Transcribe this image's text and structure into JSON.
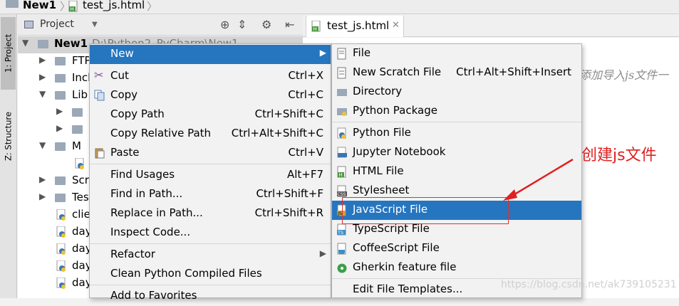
{
  "titlebar": {
    "project": "New1",
    "file": "test_js.html"
  },
  "leftstrip": {
    "project_tab": "1: Project",
    "structure_tab": "Z: Structure"
  },
  "project_panel": {
    "label": "Project"
  },
  "tree": {
    "root": {
      "label": "New1",
      "path": "D:\\Python2_PyCharm\\New1"
    },
    "rows": [
      "FTP",
      "Incl",
      "Lib",
      "",
      "",
      "M",
      "",
      "Scr",
      "Tes",
      "clie",
      "day",
      "day",
      "day",
      "day"
    ]
  },
  "editor": {
    "tab": "test_js.html",
    "comment": "添加导入js文件一"
  },
  "context_menu": {
    "items": [
      {
        "label": "New",
        "shortcut": ""
      },
      {
        "label": "Cut",
        "shortcut": "Ctrl+X"
      },
      {
        "label": "Copy",
        "shortcut": "Ctrl+C"
      },
      {
        "label": "Copy Path",
        "shortcut": "Ctrl+Shift+C"
      },
      {
        "label": "Copy Relative Path",
        "shortcut": "Ctrl+Alt+Shift+C"
      },
      {
        "label": "Paste",
        "shortcut": "Ctrl+V"
      },
      {
        "label": "Find Usages",
        "shortcut": "Alt+F7"
      },
      {
        "label": "Find in Path...",
        "shortcut": "Ctrl+Shift+F"
      },
      {
        "label": "Replace in Path...",
        "shortcut": "Ctrl+Shift+R"
      },
      {
        "label": "Inspect Code...",
        "shortcut": ""
      },
      {
        "label": "Refactor",
        "shortcut": ""
      },
      {
        "label": "Clean Python Compiled Files",
        "shortcut": ""
      },
      {
        "label": "Add to Favorites",
        "shortcut": ""
      }
    ]
  },
  "new_submenu": {
    "items": [
      {
        "label": "File",
        "shortcut": ""
      },
      {
        "label": "New Scratch File",
        "shortcut": "Ctrl+Alt+Shift+Insert"
      },
      {
        "label": "Directory",
        "shortcut": ""
      },
      {
        "label": "Python Package",
        "shortcut": ""
      },
      {
        "label": "Python File",
        "shortcut": ""
      },
      {
        "label": "Jupyter Notebook",
        "shortcut": ""
      },
      {
        "label": "HTML File",
        "shortcut": ""
      },
      {
        "label": "Stylesheet",
        "shortcut": ""
      },
      {
        "label": "JavaScript File",
        "shortcut": ""
      },
      {
        "label": "TypeScript File",
        "shortcut": ""
      },
      {
        "label": "CoffeeScript File",
        "shortcut": ""
      },
      {
        "label": "Gherkin feature file",
        "shortcut": ""
      },
      {
        "label": "Edit File Templates...",
        "shortcut": ""
      }
    ]
  },
  "annotation": {
    "text": "创建js文件",
    "color": "#e02020"
  },
  "watermark": "https://blog.csdn.net/ak739105231",
  "colors": {
    "selection": "#2675bf",
    "menu_bg": "#f2f2f2"
  }
}
